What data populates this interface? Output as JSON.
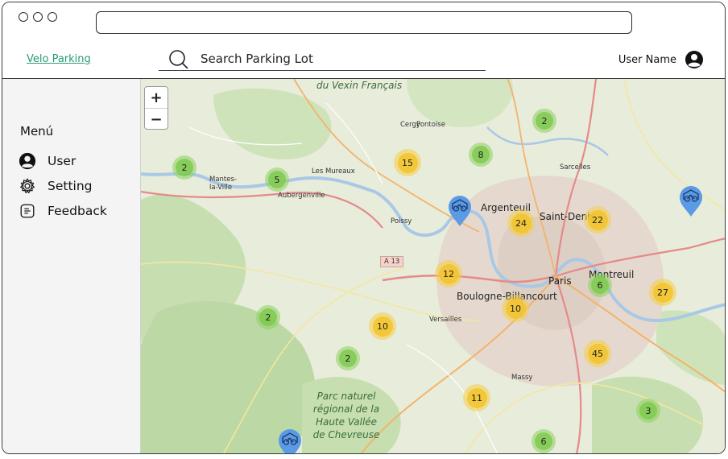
{
  "header": {
    "brand": "Velo Parking",
    "search_placeholder": "Search Parking Lot",
    "user_name": "User Name"
  },
  "sidebar": {
    "menu_title": "Menú",
    "items": [
      {
        "label": "User",
        "icon": "user-circle-icon"
      },
      {
        "label": "Setting",
        "icon": "gear-icon"
      },
      {
        "label": "Feedback",
        "icon": "feedback-icon"
      }
    ]
  },
  "map": {
    "zoom_in": "+",
    "zoom_out": "−",
    "clusters": [
      {
        "count": "2",
        "color": "green"
      },
      {
        "count": "5",
        "color": "green"
      },
      {
        "count": "15",
        "color": "yellow"
      },
      {
        "count": "8",
        "color": "green"
      },
      {
        "count": "2",
        "color": "green"
      },
      {
        "count": "24",
        "color": "yellow"
      },
      {
        "count": "22",
        "color": "yellow"
      },
      {
        "count": "12",
        "color": "yellow"
      },
      {
        "count": "6",
        "color": "green"
      },
      {
        "count": "27",
        "color": "yellow"
      },
      {
        "count": "2",
        "color": "green"
      },
      {
        "count": "10",
        "color": "yellow"
      },
      {
        "count": "10",
        "color": "yellow"
      },
      {
        "count": "2",
        "color": "green"
      },
      {
        "count": "45",
        "color": "yellow"
      },
      {
        "count": "11",
        "color": "yellow"
      },
      {
        "count": "3",
        "color": "green"
      },
      {
        "count": "6",
        "color": "green"
      }
    ],
    "labels": {
      "paris": "Paris",
      "saint_denis": "Saint-Denis",
      "argenteuil": "Argenteuil",
      "boulogne": "Boulogne-Billancourt",
      "montreuil": "Montreuil",
      "mantes": "Mantes-la-Ville",
      "les_mureaux": "Les Mureaux",
      "aubergenville": "Aubergenville",
      "poissy": "Poissy",
      "versailles": "Versailles",
      "cergy": "Cergy",
      "pontoise": "Pontoise",
      "sarcelles": "Sarcelles",
      "massy": "Massy",
      "a13": "A 13",
      "park": "Parc naturel régional de la Haute Vallée de Chevreuse",
      "vexin": "du Vexin Français"
    },
    "colors": {
      "accent": "#2a9a74",
      "pin": "#5b9be6",
      "cluster_green": "#80ca50",
      "cluster_yellow": "#f2c430"
    }
  }
}
